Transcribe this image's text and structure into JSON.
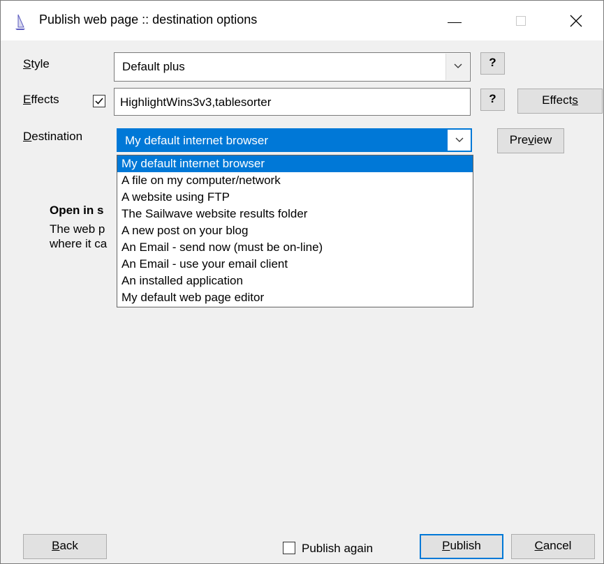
{
  "window": {
    "title": "Publish web page :: destination options"
  },
  "style": {
    "label": "Style",
    "value": "Default plus",
    "help_label": "?"
  },
  "effects": {
    "label": "Effects",
    "value": "HighlightWins3v3,tablesorter",
    "help_label": "?",
    "button_label": "Effects",
    "checked": true
  },
  "destination": {
    "label": "Destination",
    "value": "My default internet browser",
    "preview_label": "Preview",
    "options": [
      "My default internet browser",
      "A file on my computer/network",
      "A website using FTP",
      "The Sailwave website results folder",
      "A new post on your blog",
      "An Email - send now (must be on-line)",
      "An Email - use your email client",
      "An installed application",
      "My default web page editor"
    ]
  },
  "info": {
    "heading": "Open in s",
    "line1": "The web p",
    "line2": "where it ca"
  },
  "footer": {
    "back_label": "Back",
    "publish_again_label": "Publish again",
    "publish_label": "Publish",
    "cancel_label": "Cancel"
  },
  "colors": {
    "accent": "#0078d7",
    "face": "#f0f0f0"
  }
}
